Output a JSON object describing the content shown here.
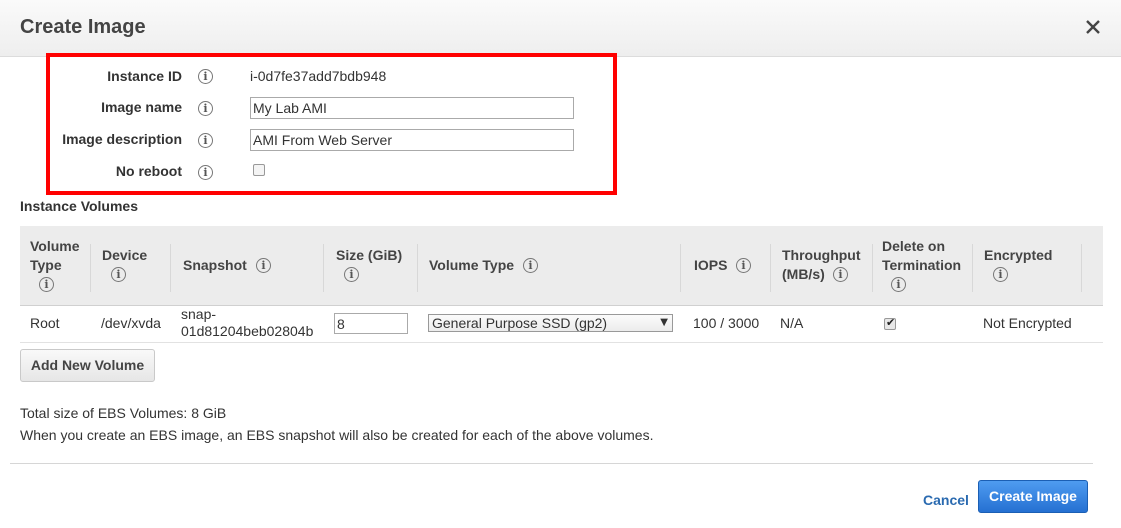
{
  "dialog": {
    "title": "Create Image"
  },
  "form": {
    "instance_id_label": "Instance ID",
    "instance_id_value": "i-0d7fe37add7bdb948",
    "image_name_label": "Image name",
    "image_name_value": "My Lab AMI",
    "image_description_label": "Image description",
    "image_description_value": "AMI From Web Server",
    "no_reboot_label": "No reboot",
    "no_reboot_checked": false
  },
  "volumes": {
    "section_label": "Instance Volumes",
    "headers": {
      "volume_type_1": "Volume",
      "volume_type_2": "Type",
      "device": "Device",
      "snapshot": "Snapshot",
      "size": "Size (GiB)",
      "vol_type": "Volume Type",
      "iops": "IOPS",
      "throughput_1": "Throughput",
      "throughput_2": "(MB/s)",
      "delete_1": "Delete on",
      "delete_2": "Termination",
      "encrypted": "Encrypted"
    },
    "rows": [
      {
        "volume_type": "Root",
        "device": "/dev/xvda",
        "snapshot_1": "snap-",
        "snapshot_2": "01d81204beb02804b",
        "size": "8",
        "vol_type": "General Purpose SSD (gp2)",
        "iops": "100 / 3000",
        "throughput": "N/A",
        "delete_on_termination": true,
        "encrypted": "Not Encrypted"
      }
    ],
    "add_button_label": "Add New Volume"
  },
  "notes": {
    "total_size": "Total size of EBS Volumes: 8 GiB",
    "snapshot_note": "When you create an EBS image, an EBS snapshot will also be created for each of the above volumes."
  },
  "footer": {
    "cancel_label": "Cancel",
    "create_label": "Create Image"
  },
  "icons": {
    "info": "info-icon",
    "close": "close-icon",
    "dropdown": "caret-down-icon"
  },
  "colors": {
    "highlight_box": "#ff0000",
    "primary_button": "#2f7fe0",
    "link": "#2a6ab0"
  }
}
